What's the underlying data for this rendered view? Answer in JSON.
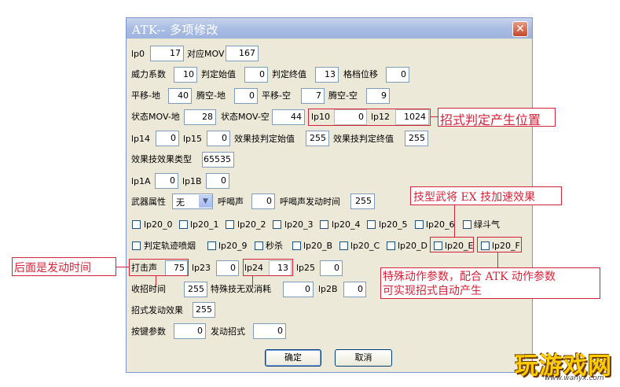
{
  "window": {
    "title": "ATK-- 多项修改",
    "close": "✕"
  },
  "rows": {
    "r1": {
      "lp0_label": "lp0",
      "lp0_value": "17",
      "mov_label": "对应MOV",
      "mov_value": "167"
    },
    "r2": {
      "power_label": "威力系数",
      "power_value": "10",
      "jstart_label": "判定始值",
      "jstart_value": "0",
      "jend_label": "判定终值",
      "jend_value": "13",
      "grid_label": "格档位移",
      "grid_value": "0"
    },
    "r3": {
      "pg_label": "平移-地",
      "pg_value": "40",
      "tg_label": "腾空-地",
      "tg_value": "0",
      "pa_label": "平移-空",
      "pa_value": "7",
      "ta_label": "腾空-空",
      "ta_value": "9"
    },
    "r4": {
      "sg_label": "状态MOV-地",
      "sg_value": "28",
      "sa_label": "状态MOV-空",
      "sa_value": "44",
      "lp10_label": "lp10",
      "lp10_value": "0",
      "lp12_label": "lp12",
      "lp12_value": "1024"
    },
    "r5": {
      "lp14_label": "lp14",
      "lp14_value": "0",
      "lp15_label": "lp15",
      "lp15_value": "0",
      "es_label": "效果技判定始值",
      "es_value": "255",
      "ee_label": "效果技判定终值",
      "ee_value": "255"
    },
    "r6": {
      "etype_label": "效果技效果类型",
      "etype_value": "65535"
    },
    "r7": {
      "lp1a_label": "lp1A",
      "lp1a_value": "0",
      "lp1b_label": "lp1B",
      "lp1b_value": "0"
    },
    "r8": {
      "weapon_label": "武器属性",
      "weapon_value": "无",
      "shout_label": "呼喝声",
      "shout_value": "0",
      "shouttime_label": "呼喝声发动时间",
      "shouttime_value": "255"
    },
    "checks1": [
      "lp20_0",
      "lp20_1",
      "lp20_2",
      "lp20_3",
      "lp20_4",
      "lp20_5",
      "lp20_6",
      "绿斗气"
    ],
    "checks2": [
      "判定轨迹喷烟",
      "lp20_9",
      "秒杀",
      "lp20_B",
      "lp20_C",
      "lp20_D",
      "lp20_E",
      "lp20_F"
    ],
    "r11": {
      "hit_label": "打击声",
      "hit_value": "75",
      "lp23_label": "lp23",
      "lp23_value": "0",
      "lp24_label": "lp24",
      "lp24_value": "13",
      "lp25_label": "lp25",
      "lp25_value": "0"
    },
    "r12": {
      "recover_label": "收招时间",
      "recover_value": "255",
      "special_label": "特殊技无双消耗",
      "special_value": "0",
      "lp2b_label": "lp2B",
      "lp2b_value": "0"
    },
    "r13": {
      "effect_label": "招式发动效果",
      "effect_value": "255"
    },
    "r14": {
      "key_label": "按键参数",
      "key_value": "0",
      "move_label": "发动招式",
      "move_value": "0"
    },
    "buttons": {
      "ok": "确定",
      "cancel": "取消"
    }
  },
  "annotations": {
    "position": "招式判定产生位置",
    "ex": "技型武将 EX 技加速效果",
    "after": "后面是发动时间",
    "special_line1": "特殊动作参数，配合 ATK 动作参数",
    "special_line2": "可实现招式自动产生"
  },
  "watermark": {
    "logo": "玩游戏网",
    "url": "www.wanyx.com"
  },
  "colors": {
    "annotation": "#d3233a",
    "titlebar": "#a9bde3",
    "dialog": "#ece9d8"
  }
}
